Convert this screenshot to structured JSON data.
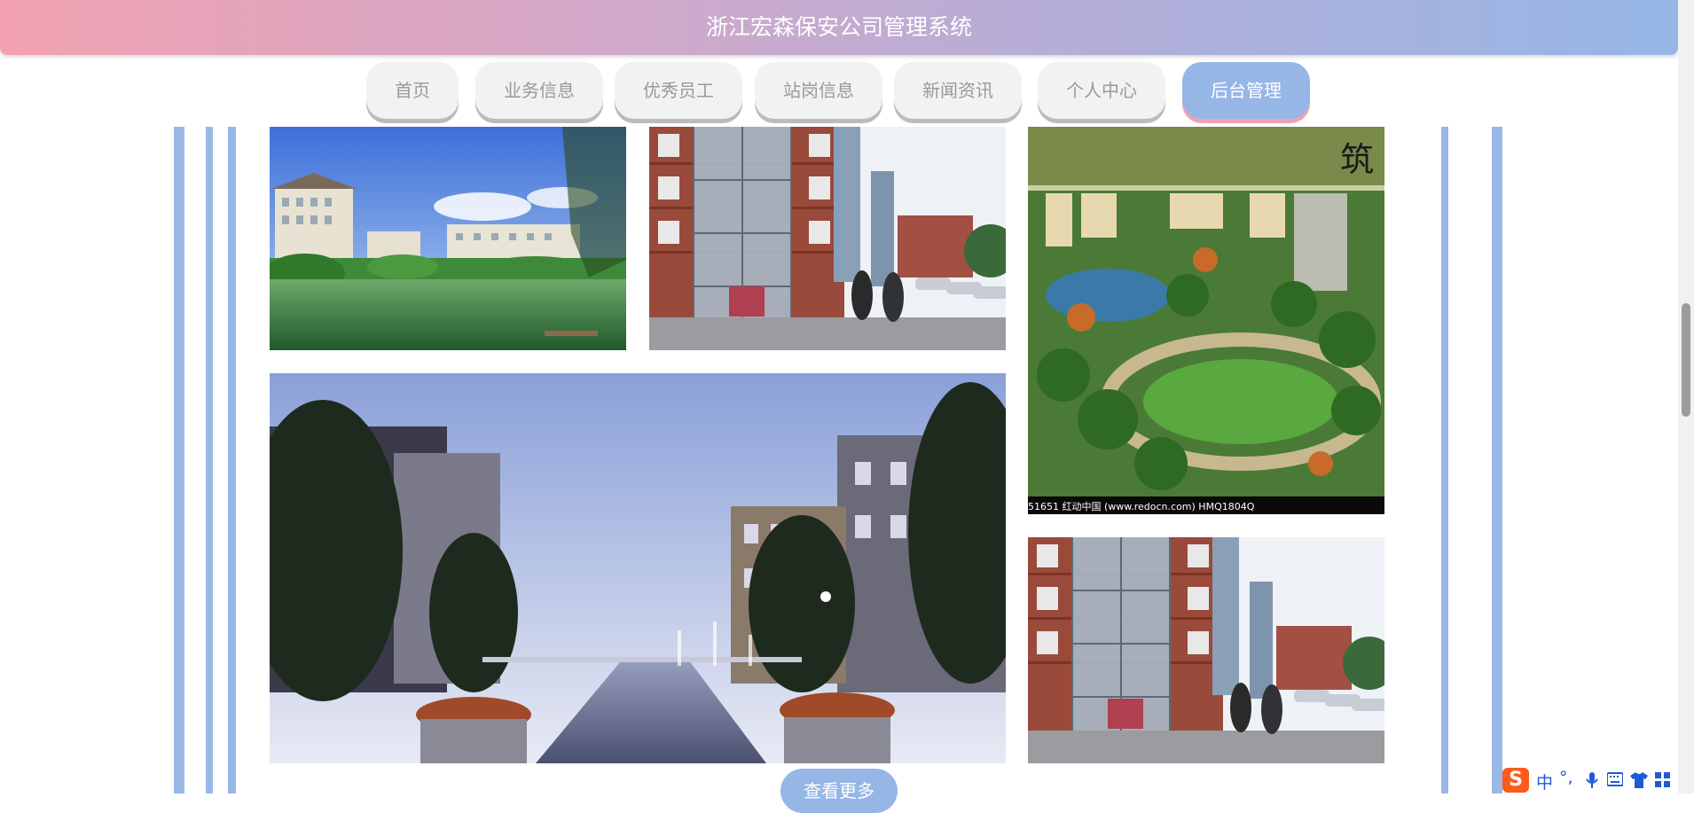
{
  "header": {
    "title": "浙江宏森保安公司管理系统"
  },
  "nav": {
    "items": [
      {
        "label": "首页",
        "active": false
      },
      {
        "label": "业务信息",
        "active": false
      },
      {
        "label": "优秀员工",
        "active": false
      },
      {
        "label": "站岗信息",
        "active": false
      },
      {
        "label": "新闻资讯",
        "active": false
      },
      {
        "label": "个人中心",
        "active": false
      },
      {
        "label": "后台管理",
        "active": true
      }
    ]
  },
  "gallery": {
    "photos": [
      {
        "subject": "lakeside residential buildings under blue sky"
      },
      {
        "subject": "apartment block with glass elevator shaft, watermarked"
      },
      {
        "subject": "aerial rendering of community garden plaza",
        "caption": "51651    红动中国 (www.redocn.com)    HMQ1804Q"
      },
      {
        "subject": "residential courtyard with fountains at dusk"
      },
      {
        "subject": "apartment block with glass elevator shaft, watermarked"
      }
    ]
  },
  "more_button": {
    "label": "查看更多"
  },
  "ime": {
    "logo": "S",
    "mode": "中",
    "punct": "°,"
  },
  "colors": {
    "accent_blue": "#96b6e6",
    "accent_pink": "#f2a2b2",
    "stripe": "#9ab8e6"
  }
}
